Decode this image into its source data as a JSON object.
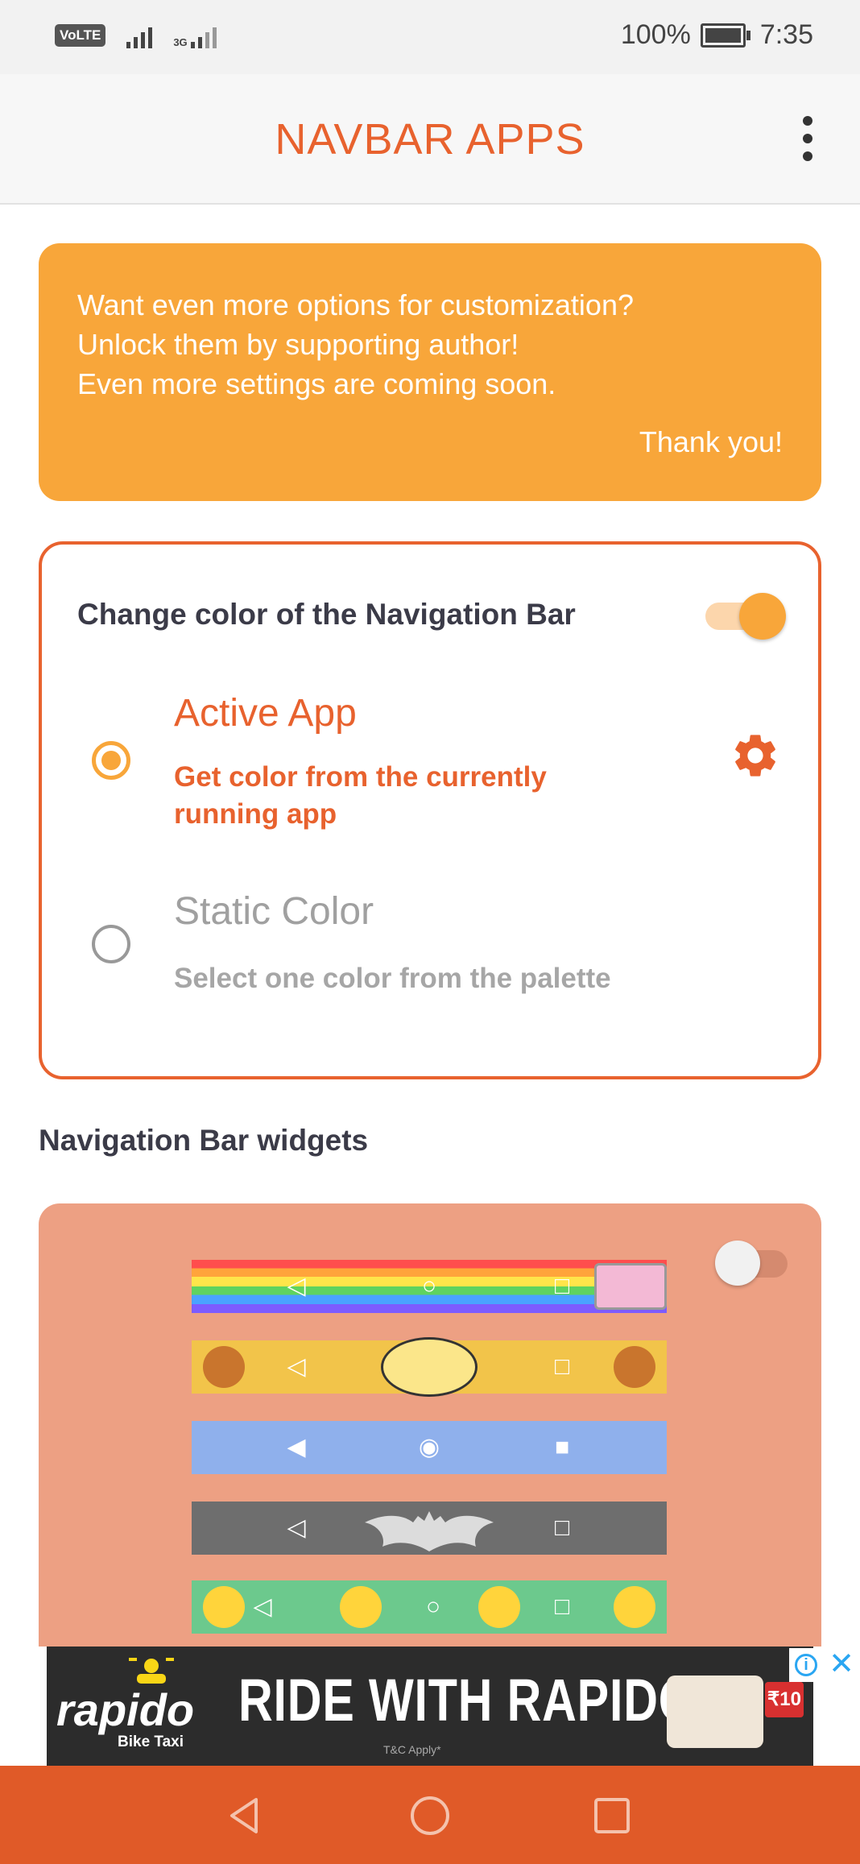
{
  "status_bar": {
    "volte": "VoLTE",
    "network": "3G",
    "battery": "100%",
    "time": "7:35"
  },
  "app_bar": {
    "title": "NAVBAR APPS",
    "menu_icon": "more-vert-icon"
  },
  "promo": {
    "line1": "Want even more options for customization?",
    "line2": "Unlock them by supporting author!",
    "line3": "Even more settings are coming soon.",
    "thanks": "Thank you!",
    "color": "#f8a63a"
  },
  "color_card": {
    "title": "Change color of the Navigation Bar",
    "enabled": true,
    "options": [
      {
        "title": "Active App",
        "description_line1": "Get color from the currently",
        "description_line2": "running app",
        "selected": true
      },
      {
        "title": "Static Color",
        "description": "Select one color from the palette",
        "selected": false
      }
    ],
    "settings_icon": "gear-icon",
    "accent": "#e8622e"
  },
  "widgets": {
    "title": "Navigation Bar widgets",
    "enabled": false,
    "previews": [
      "nyan-cat-navbar",
      "garfield-navbar",
      "pixel-navbar",
      "batman-navbar",
      "emoji-navbar"
    ]
  },
  "ad": {
    "brand": "rapido",
    "brand_sub": "Bike Taxi",
    "headline": "RIDE WITH RAPIDO",
    "terms": "T&C Apply*",
    "price": "₹10"
  },
  "system_nav": {
    "back": "back-icon",
    "home": "home-icon",
    "recents": "recents-icon",
    "color": "#e05a28"
  }
}
